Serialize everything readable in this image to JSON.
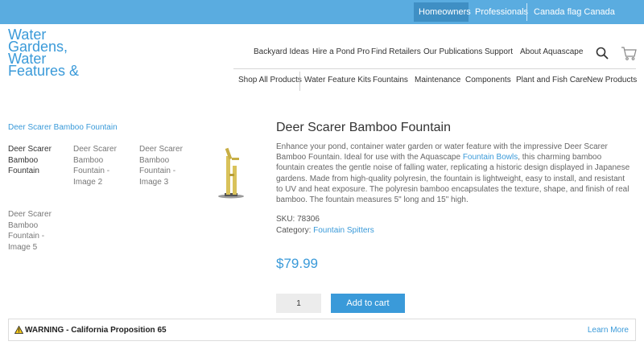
{
  "topbar": {
    "homeowners": "Homeowners",
    "professionals": "Professionals",
    "canada": "Canada flag  Canada"
  },
  "logo": {
    "text": "Water Gardens, Water Features & Ecosystem"
  },
  "nav_primary": [
    "Backyard Ideas",
    "Hire a Pond Pro",
    "Find Retailers",
    "Our Publications",
    "Support",
    "About Aquascape"
  ],
  "icons": {
    "search": "search-icon",
    "cart": "cart-icon",
    "warning": "warning-triangle-icon"
  },
  "nav_secondary": [
    "Shop All Products",
    "Water Feature Kits",
    "Fountains",
    "Maintenance",
    "Components",
    "Plant and Fish Care",
    "New Products"
  ],
  "gallery": {
    "breadcrumb": "Deer Scarer Bamboo Fountain",
    "thumbs": [
      "Deer Scarer Bamboo Fountain",
      "Deer Scarer Bamboo Fountain - Image 2",
      "Deer Scarer Bamboo Fountain - Image 3",
      "Deer Scarer Bamboo Fountain - Image 5"
    ]
  },
  "product": {
    "title": "Deer Scarer Bamboo Fountain",
    "desc_before": "Enhance your pond, container water garden or water feature with the impressive Deer Scarer Bamboo Fountain. Ideal for use with the Aquascape ",
    "desc_link": "Fountain Bowls",
    "desc_after": ", this charming bamboo fountain creates the gentle noise of falling water, replicating a historic design displayed in Japanese gardens. Made from high-quality polyresin, the fountain is lightweight, easy to install, and resistant to UV and heat exposure. The polyresin bamboo encapsulates the texture, shape, and finish of real bamboo. The fountain measures 5\" long and 15\" high.",
    "sku_label": "SKU: 78306",
    "category_label": "Category: ",
    "category_link": "Fountain Spitters",
    "price": "$79.99",
    "quantity": "1",
    "add_to_cart": "Add to cart"
  },
  "warning": {
    "text": "WARNING - California Proposition 65",
    "learn_more": "Learn More"
  },
  "colors": {
    "accent": "#3a9ad9",
    "topbar": "#5aace0",
    "topbar_active": "#3f8fc4"
  }
}
